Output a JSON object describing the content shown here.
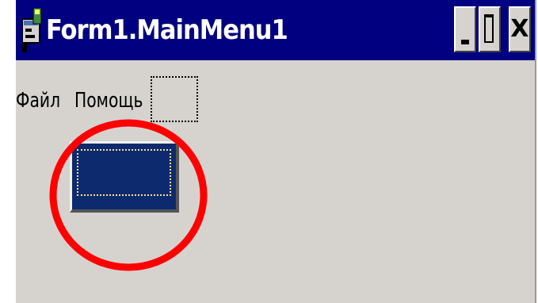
{
  "window": {
    "title": "Form1.MainMenu1",
    "icon": "app-form-icon",
    "controls": {
      "minimize": "minimize-icon",
      "maximize": "maximize-icon",
      "close_label": "X"
    }
  },
  "menu": {
    "items": [
      {
        "label": "Файл"
      },
      {
        "label": "Помощь"
      }
    ],
    "placeholder": "new-menu-item-placeholder"
  },
  "component": {
    "icon": "main-menu-component-icon",
    "selected": true
  },
  "annotation": {
    "shape": "circle",
    "color": "#ff0000"
  },
  "colors": {
    "titlebar": "#000080",
    "title_text": "#ffffff",
    "window_bg": "#d6d3ce",
    "component_fill": "#0e2a6e",
    "focus_dots": "#f4e48c"
  }
}
